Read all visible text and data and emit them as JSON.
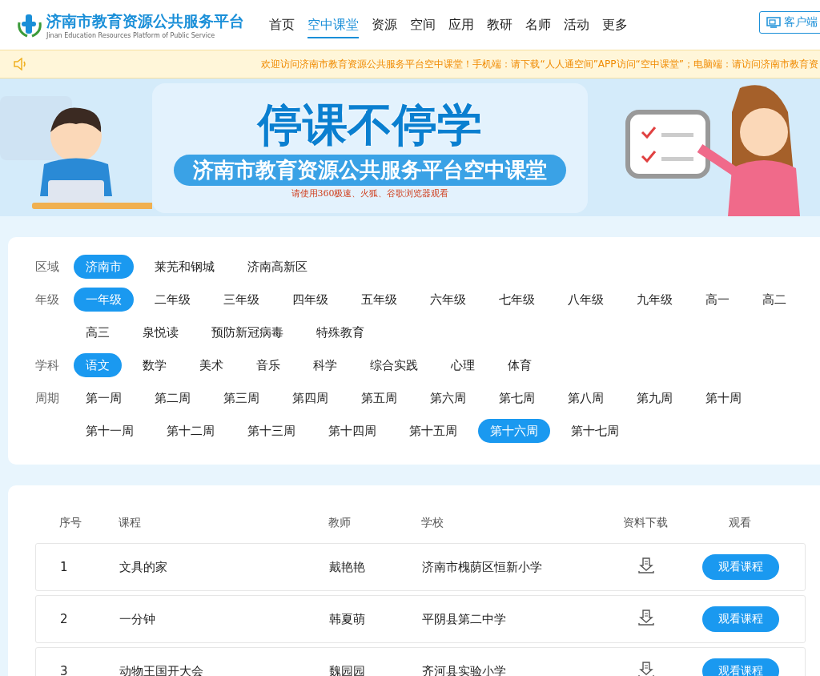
{
  "header": {
    "logo_title": "济南市教育资源公共服务平台",
    "logo_subtitle": "Jinan Education Resources Platform of Public Service",
    "nav": [
      {
        "label": "首页",
        "selected": false
      },
      {
        "label": "空中课堂",
        "selected": true
      },
      {
        "label": "资源",
        "selected": false
      },
      {
        "label": "空间",
        "selected": false
      },
      {
        "label": "应用",
        "selected": false
      },
      {
        "label": "教研",
        "selected": false
      },
      {
        "label": "名师",
        "selected": false
      },
      {
        "label": "活动",
        "selected": false
      },
      {
        "label": "更多",
        "selected": false
      }
    ],
    "client_button": "客户端"
  },
  "notice": "欢迎访问济南市教育资源公共服务平台空中课堂！手机端：请下载“人人通空间”APP访问“空中课堂”；电脑端：请访问济南市教育资",
  "banner": {
    "headline": "停课不停学",
    "subtitle": "济南市教育资源公共服务平台空中课堂",
    "note": "请使用360极速、火狐、谷歌浏览器观看"
  },
  "filters": [
    {
      "label": "区域",
      "options": [
        {
          "label": "济南市",
          "selected": true
        },
        {
          "label": "莱芜和钢城",
          "selected": false
        },
        {
          "label": "济南高新区",
          "selected": false
        }
      ]
    },
    {
      "label": "年级",
      "options": [
        {
          "label": "一年级",
          "selected": true
        },
        {
          "label": "二年级",
          "selected": false
        },
        {
          "label": "三年级",
          "selected": false
        },
        {
          "label": "四年级",
          "selected": false
        },
        {
          "label": "五年级",
          "selected": false
        },
        {
          "label": "六年级",
          "selected": false
        },
        {
          "label": "七年级",
          "selected": false
        },
        {
          "label": "八年级",
          "selected": false
        },
        {
          "label": "九年级",
          "selected": false
        },
        {
          "label": "高一",
          "selected": false
        },
        {
          "label": "高二",
          "selected": false
        },
        {
          "label": "高三",
          "selected": false
        },
        {
          "label": "泉悦读",
          "selected": false
        },
        {
          "label": "预防新冠病毒",
          "selected": false
        },
        {
          "label": "特殊教育",
          "selected": false
        }
      ]
    },
    {
      "label": "学科",
      "options": [
        {
          "label": "语文",
          "selected": true
        },
        {
          "label": "数学",
          "selected": false
        },
        {
          "label": "美术",
          "selected": false
        },
        {
          "label": "音乐",
          "selected": false
        },
        {
          "label": "科学",
          "selected": false
        },
        {
          "label": "综合实践",
          "selected": false
        },
        {
          "label": "心理",
          "selected": false
        },
        {
          "label": "体育",
          "selected": false
        }
      ]
    },
    {
      "label": "周期",
      "options": [
        {
          "label": "第一周",
          "selected": false
        },
        {
          "label": "第二周",
          "selected": false
        },
        {
          "label": "第三周",
          "selected": false
        },
        {
          "label": "第四周",
          "selected": false
        },
        {
          "label": "第五周",
          "selected": false
        },
        {
          "label": "第六周",
          "selected": false
        },
        {
          "label": "第七周",
          "selected": false
        },
        {
          "label": "第八周",
          "selected": false
        },
        {
          "label": "第九周",
          "selected": false
        },
        {
          "label": "第十周",
          "selected": false
        },
        {
          "label": "第十一周",
          "selected": false
        },
        {
          "label": "第十二周",
          "selected": false
        },
        {
          "label": "第十三周",
          "selected": false
        },
        {
          "label": "第十四周",
          "selected": false
        },
        {
          "label": "第十五周",
          "selected": false
        },
        {
          "label": "第十六周",
          "selected": true
        },
        {
          "label": "第十七周",
          "selected": false
        }
      ]
    }
  ],
  "table": {
    "columns": [
      "序号",
      "课程",
      "教师",
      "学校",
      "资料下载",
      "观看"
    ],
    "rows": [
      {
        "index": "1",
        "course": "文具的家",
        "teacher": "戴艳艳",
        "school": "济南市槐荫区恒新小学",
        "action": "观看课程"
      },
      {
        "index": "2",
        "course": "一分钟",
        "teacher": "韩夏萌",
        "school": "平阴县第二中学",
        "action": "观看课程"
      },
      {
        "index": "3",
        "course": "动物王国开大会",
        "teacher": "魏园园",
        "school": "齐河县实验小学",
        "action": "观看课程"
      }
    ]
  }
}
